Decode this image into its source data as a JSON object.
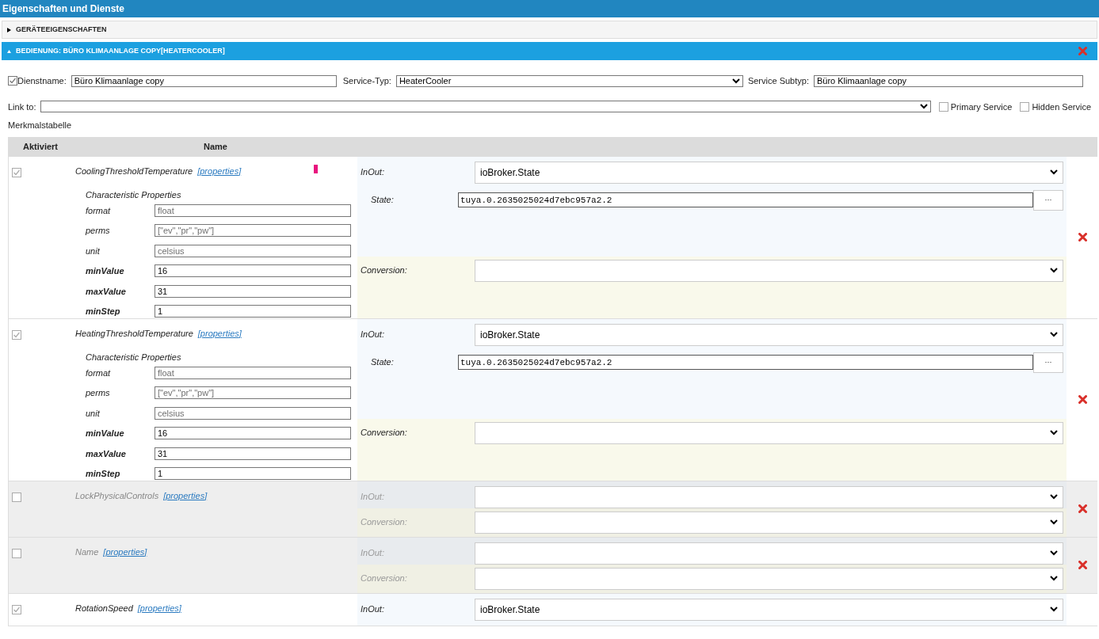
{
  "panel": {
    "title": "Eigenschaften und Dienste"
  },
  "sections": [
    {
      "title": "GERÄTEEIGENSCHAFTEN",
      "expanded": false
    },
    {
      "title": "BEDIENUNG: BÜRO KLIMAANLAGE COPY[HEATERCOOLER]",
      "expanded": true
    }
  ],
  "service": {
    "enabled": true,
    "name_label": "Dienstname:",
    "name": "Büro Klimaanlage copy",
    "type_label": "Service-Typ:",
    "type": "HeaterCooler",
    "subtype_label": "Service Subtyp:",
    "subtype": "Büro Klimaanlage copy",
    "link_label": "Link to:",
    "options": [
      {
        "label": "Primary Service",
        "checked": false
      },
      {
        "label": "Hidden Service",
        "checked": false
      }
    ]
  },
  "table": {
    "title": "Merkmalstabelle",
    "columns": [
      "Aktiviert",
      "Name"
    ],
    "rows": [
      {
        "enabled": true,
        "cursor_mark": true,
        "name": "CoolingThresholdTemperature",
        "link": "[properties]",
        "properties": {
          "title": "Characteristic Properties",
          "fields": [
            {
              "label": "format",
              "value": "float",
              "required": false,
              "readonly": true
            },
            {
              "label": "perms",
              "value": "[\"ev\",\"pr\",\"pw\"]",
              "required": false,
              "readonly": true
            },
            {
              "label": "unit",
              "value": "celsius",
              "required": false,
              "readonly": true
            },
            {
              "label": "minValue",
              "value": "16",
              "required": true,
              "readonly": false
            },
            {
              "label": "maxValue",
              "value": "31",
              "required": true,
              "readonly": false
            },
            {
              "label": "minStep",
              "value": "1",
              "required": true,
              "readonly": false
            }
          ]
        },
        "inout": {
          "label": "InOut:",
          "value": "ioBroker.State"
        },
        "state": {
          "label": "State:",
          "value": "tuya.0.2635025024d7ebc957a2.2",
          "button": "···"
        },
        "conversion": {
          "label": "Conversion:"
        }
      },
      {
        "enabled": true,
        "cursor_mark": false,
        "name": "HeatingThresholdTemperature",
        "link": "[properties]",
        "properties": {
          "title": "Characteristic Properties",
          "fields": [
            {
              "label": "format",
              "value": "float",
              "required": false,
              "readonly": true
            },
            {
              "label": "perms",
              "value": "[\"ev\",\"pr\",\"pw\"]",
              "required": false,
              "readonly": true
            },
            {
              "label": "unit",
              "value": "celsius",
              "required": false,
              "readonly": true
            },
            {
              "label": "minValue",
              "value": "16",
              "required": true,
              "readonly": false
            },
            {
              "label": "maxValue",
              "value": "31",
              "required": true,
              "readonly": false
            },
            {
              "label": "minStep",
              "value": "1",
              "required": true,
              "readonly": false
            }
          ]
        },
        "inout": {
          "label": "InOut:",
          "value": "ioBroker.State"
        },
        "state": {
          "label": "State:",
          "value": "tuya.0.2635025024d7ebc957a2.2",
          "button": "···"
        },
        "conversion": {
          "label": "Conversion:"
        }
      },
      {
        "enabled": false,
        "name": "LockPhysicalControls",
        "link": "[properties]",
        "inout": {
          "label": "InOut:"
        },
        "conversion": {
          "label": "Conversion:"
        }
      },
      {
        "enabled": false,
        "name": "Name",
        "link": "[properties]",
        "inout": {
          "label": "InOut:"
        },
        "conversion": {
          "label": "Conversion:"
        }
      },
      {
        "enabled": true,
        "name": "RotationSpeed",
        "link": "[properties]",
        "inout": {
          "label": "InOut:",
          "value": "ioBroker.State"
        }
      }
    ]
  }
}
